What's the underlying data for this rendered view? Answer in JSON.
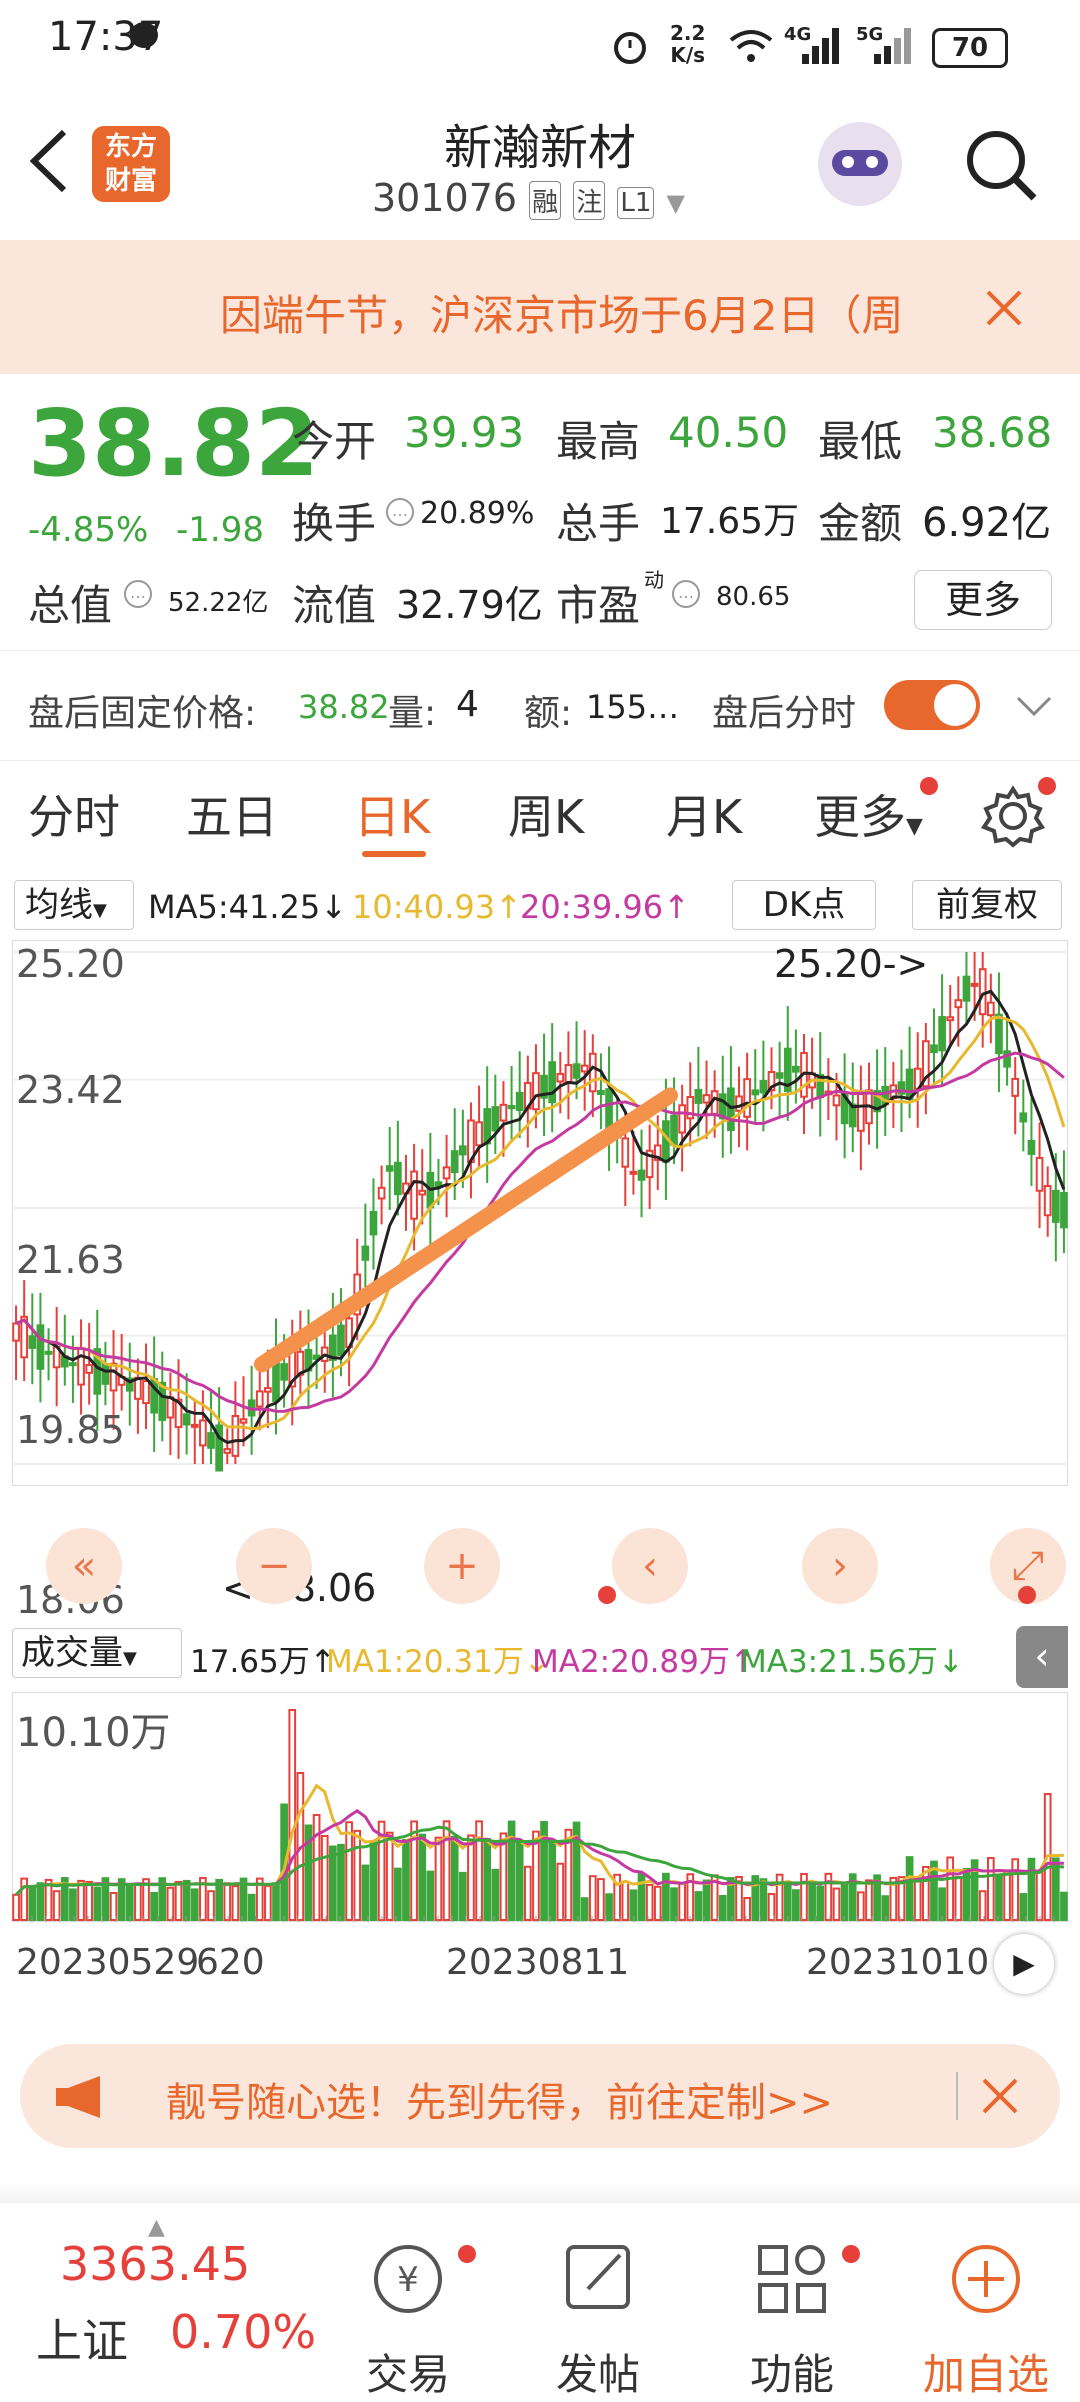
{
  "status_bar": {
    "time": "17:37",
    "net_speed_top": "2.2",
    "net_speed_bottom": "K/s",
    "net1": "4G",
    "net2": "5G",
    "battery": "70"
  },
  "header": {
    "logo_line1": "东方",
    "logo_line2": "财富",
    "stock_name": "新瀚新材",
    "stock_code": "301076",
    "tag1": "融",
    "tag2": "注",
    "tag3": "L1"
  },
  "notice": {
    "text": "因端午节，沪深京市场于6月2日（周"
  },
  "quote": {
    "price": "38.82",
    "change_pct": "-4.85%",
    "change_amt": "-1.98",
    "open_label": "今开",
    "open_val": "39.93",
    "high_label": "最高",
    "high_val": "40.50",
    "low_label": "最低",
    "low_val": "38.68",
    "turnover_label": "换手",
    "turnover_val": "20.89%",
    "volume_label": "总手",
    "volume_val": "17.65万",
    "amount_label": "金额",
    "amount_val": "6.92亿",
    "mktcap_label": "总值",
    "mktcap_val": "52.22亿",
    "float_label": "流值",
    "float_val": "32.79亿",
    "pe_label": "市盈",
    "pe_sup": "动",
    "pe_val": "80.65",
    "more_btn": "更多",
    "after_label": "盘后固定价格:",
    "after_price": "38.82",
    "after_vol_label": "量:",
    "after_vol": "4",
    "after_amt_label": "额:",
    "after_amt": "155…",
    "after_time_label": "盘后分时"
  },
  "tabs": [
    "分时",
    "五日",
    "日K",
    "周K",
    "月K",
    "更多"
  ],
  "active_tab": 2,
  "kline_header": {
    "ma_select": "均线",
    "ma5": "MA5:41.25",
    "ma10": "10:40.93",
    "ma20": "20:39.96",
    "dk_btn": "DK点",
    "fq_btn": "前复权"
  },
  "chart_labels": {
    "y_ticks": [
      "25.20",
      "23.42",
      "21.63",
      "19.85",
      "18.06"
    ],
    "max_label": "25.20->",
    "min_label": "<-18.06"
  },
  "vol_header": {
    "select": "成交量",
    "vol": "17.65万",
    "ma1": "MA1:20.31万",
    "ma2": "MA2:20.89万",
    "ma3": "MA3:21.56万",
    "max_label": "10.10万"
  },
  "x_labels": [
    "20230529",
    "20230811",
    "20231010"
  ],
  "x_label_overlap": "620",
  "colors": {
    "up": "#e5403a",
    "down": "#3ca53c",
    "ma5": "#222222",
    "ma10": "#e8b92f",
    "ma20": "#c43aa0",
    "trendline": "#f4914a",
    "accent": "#e8672c"
  },
  "ad": {
    "text": "靓号随心选！先到先得，前往定制>>"
  },
  "bottom": {
    "index_val": "3363.45",
    "index_name": "上证",
    "index_pct": "0.70%",
    "nav": [
      "交易",
      "发帖",
      "功能",
      "加自选"
    ]
  },
  "chart_data": {
    "type": "candlestick",
    "ylim": [
      18.06,
      25.2
    ],
    "yticks": [
      25.2,
      23.42,
      21.63,
      19.85,
      18.06
    ],
    "xlabels": [
      "20230529",
      "20230811",
      "20231010"
    ],
    "price_high": 25.2,
    "price_low": 18.06,
    "volume_max": "10.10万",
    "ma_latest": {
      "MA5": 41.25,
      "MA10": 40.93,
      "MA20": 39.96
    },
    "vol_ma_latest": {
      "MA1": "20.31万",
      "MA2": "20.89万",
      "MA3": "21.56万"
    }
  }
}
